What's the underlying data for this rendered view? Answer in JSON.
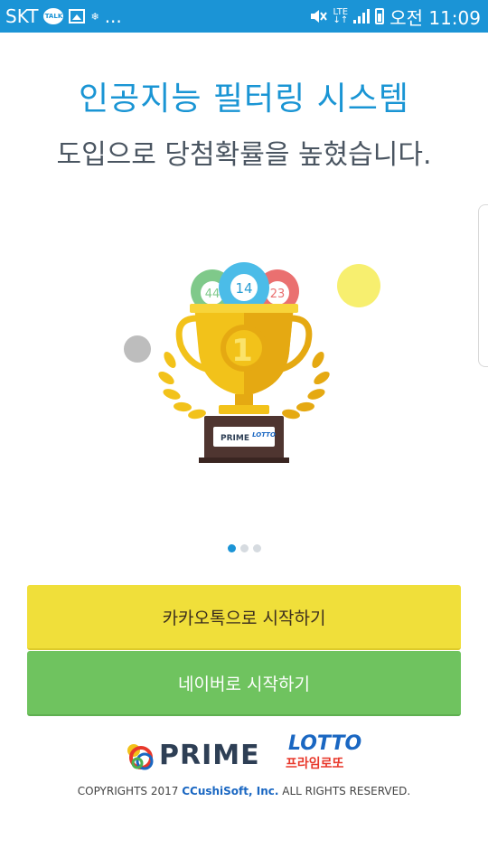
{
  "status_bar": {
    "carrier": "SKT",
    "talk_badge": "TALK",
    "small_icon_text": "❄",
    "more": "...",
    "lte": "LTE",
    "time": "오전 11:09",
    "mute_icon": "mute-icon",
    "signal_icon": "signal-icon",
    "battery_icon": "battery-charging-icon"
  },
  "headline": {
    "title": "인공지능 필터링 시스템",
    "subtitle": "도입으로 당첨확률을 높혔습니다."
  },
  "illustration": {
    "ball_left": "44",
    "ball_center": "14",
    "ball_right": "23",
    "trophy_number": "1",
    "plaque_prime": "PRIME",
    "plaque_lotto": "LOTTO"
  },
  "pager": {
    "count": 3,
    "active_index": 0
  },
  "buttons": {
    "kakao": "카카오톡으로 시작하기",
    "naver": "네이버로 시작하기"
  },
  "logo": {
    "prime": "PRIME",
    "lotto": "LOTTO",
    "korean": "프라임로또"
  },
  "footer": {
    "prefix": "COPYRIGHTS 2017 ",
    "company": "CCushiSoft, Inc.",
    "suffix": " ALL RIGHTS RESERVED."
  },
  "colors": {
    "status_bar": "#1b94d6",
    "title": "#1a95d4",
    "kakao": "#f0df3a",
    "naver": "#6fc35f",
    "trophy": "#f2c21a"
  }
}
